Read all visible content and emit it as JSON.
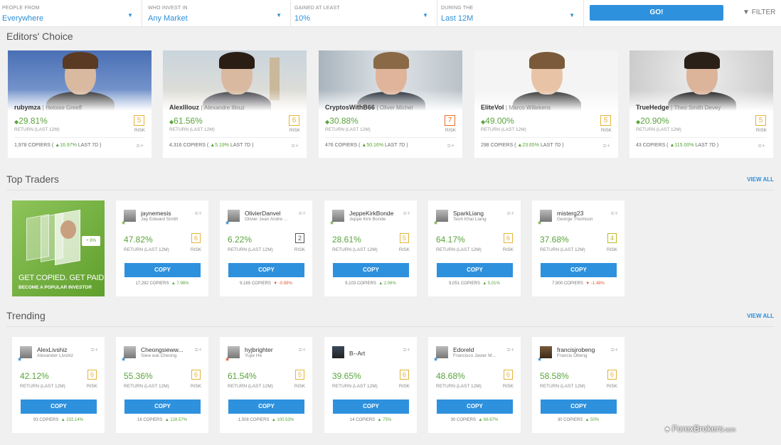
{
  "filters": [
    {
      "label": "PEOPLE FROM",
      "value": "Everywhere"
    },
    {
      "label": "WHO INVEST IN",
      "value": "Any Market"
    },
    {
      "label": "GAINED AT LEAST",
      "value": "10%"
    },
    {
      "label": "DURING THE",
      "value": "Last 12M"
    }
  ],
  "go_label": "GO!",
  "filter_label": "FILTER",
  "editors": {
    "title": "Editors' Choice",
    "cards": [
      {
        "user": "rubymza",
        "name": "Heloise Greeff",
        "gain": "29.81%",
        "return_label": "RETURN (LAST 12M)",
        "risk": "5",
        "risk_label": "RISK",
        "copiers": "1,978 COPIERS (",
        "copiers_change": "16.97%",
        "period": "LAST 7D )"
      },
      {
        "user": "AlexIllouz",
        "name": "Alexandre Illouz",
        "gain": "61.56%",
        "return_label": "RETURN (LAST 12M)",
        "risk": "6",
        "risk_label": "RISK",
        "copiers": "4,316 COPIERS (",
        "copiers_change": "5.19%",
        "period": "LAST 7D )"
      },
      {
        "user": "CryptosWithB66",
        "name": "Oliver Michel",
        "gain": "30.88%",
        "return_label": "RETURN (LAST 12M)",
        "risk": "7",
        "risk_label": "RISK",
        "copiers": "476 COPIERS (",
        "copiers_change": "50.16%",
        "period": "LAST 7D )"
      },
      {
        "user": "EliteVol",
        "name": "Marco Willekens",
        "gain": "49.00%",
        "return_label": "RETURN (LAST 12M)",
        "risk": "5",
        "risk_label": "RISK",
        "copiers": "298 COPIERS (",
        "copiers_change": "23.65%",
        "period": "LAST 7D )"
      },
      {
        "user": "TrueHedge",
        "name": "Theo Smith Devey",
        "gain": "20.90%",
        "return_label": "RETURN (LAST 12M)",
        "risk": "5",
        "risk_label": "RISK",
        "copiers": "43 COPIERS (",
        "copiers_change": "115.00%",
        "period": "LAST 7D )"
      }
    ]
  },
  "top": {
    "title": "Top Traders",
    "view_all": "VIEW ALL",
    "promo_line1": "GET COPIED. GET PAID",
    "promo_line2": "BECOME A POPULAR INVESTOR",
    "promo_tag": "+ 8%",
    "traders": [
      {
        "user": "jaynemesis",
        "name": "Jay Edward Smith",
        "gain": "47.82%",
        "return_label": "RETURN (LAST 12M)",
        "risk": "6",
        "risk_label": "RISK",
        "copy": "COPY",
        "copiers": "17,292 COPIERS",
        "change": "7.96%",
        "dir": "up"
      },
      {
        "user": "OlivierDanvel",
        "name": "Olivier Jean Andre ...",
        "gain": "6.22%",
        "return_label": "RETURN (LAST 12M)",
        "risk": "2",
        "risk_label": "RISK",
        "copy": "COPY",
        "copiers": "9,165 COPIERS",
        "change": "-0.89%",
        "dir": "down"
      },
      {
        "user": "JeppeKirkBonde",
        "name": "Jeppe Kirk Bonde",
        "gain": "28.61%",
        "return_label": "RETURN (LAST 12M)",
        "risk": "5",
        "risk_label": "RISK",
        "copy": "COPY",
        "copiers": "9,103 COPIERS",
        "change": "2.06%",
        "dir": "up"
      },
      {
        "user": "SparkLiang",
        "name": "Teoh Khai Liang",
        "gain": "64.17%",
        "return_label": "RETURN (LAST 12M)",
        "risk": "6",
        "risk_label": "RISK",
        "copy": "COPY",
        "copiers": "9,051 COPIERS",
        "change": "5.01%",
        "dir": "up"
      },
      {
        "user": "misterg23",
        "name": "George Thomson",
        "gain": "37.68%",
        "return_label": "RETURN (LAST 12M)",
        "risk": "4",
        "risk_label": "RISK",
        "copy": "COPY",
        "copiers": "7,900 COPIERS",
        "change": "-1.48%",
        "dir": "down"
      }
    ]
  },
  "trending": {
    "title": "Trending",
    "view_all": "VIEW ALL",
    "traders": [
      {
        "user": "AlexLivshiz",
        "name": "Alexander Livshiz",
        "gain": "42.12%",
        "return_label": "RETURN (LAST 12M)",
        "risk": "6",
        "risk_label": "RISK",
        "copy": "COPY",
        "copiers": "93 COPIERS",
        "change": "232.14%",
        "dir": "up"
      },
      {
        "user": "Cheongsieww...",
        "name": "Siew wai Cheong",
        "gain": "55.36%",
        "return_label": "RETURN (LAST 12M)",
        "risk": "6",
        "risk_label": "RISK",
        "copy": "COPY",
        "copiers": "16 COPIERS",
        "change": "128.57%",
        "dir": "up"
      },
      {
        "user": "hyjbrighter",
        "name": "Yujie He",
        "gain": "61.54%",
        "return_label": "RETURN (LAST 12M)",
        "risk": "5",
        "risk_label": "RISK",
        "copy": "COPY",
        "copiers": "1,508 COPIERS",
        "change": "100.53%",
        "dir": "up"
      },
      {
        "user": "B--Art",
        "name": "",
        "gain": "39.65%",
        "return_label": "RETURN (LAST 12M)",
        "risk": "6",
        "risk_label": "RISK",
        "copy": "COPY",
        "copiers": "14 COPIERS",
        "change": "75%",
        "dir": "up"
      },
      {
        "user": "Edoreld",
        "name": "Francisco Javier M...",
        "gain": "48.68%",
        "return_label": "RETURN (LAST 12M)",
        "risk": "6",
        "risk_label": "RISK",
        "copy": "COPY",
        "copiers": "30 COPIERS",
        "change": "66.67%",
        "dir": "up"
      },
      {
        "user": "francisjrobeng",
        "name": "Francis Obeng",
        "gain": "58.58%",
        "return_label": "RETURN (LAST 12M)",
        "risk": "6",
        "risk_label": "RISK",
        "copy": "COPY",
        "copiers": "30 COPIERS",
        "change": "50%",
        "dir": "up"
      }
    ]
  },
  "watermark": {
    "brand": "ForexBrokers",
    "tld": ".com"
  }
}
